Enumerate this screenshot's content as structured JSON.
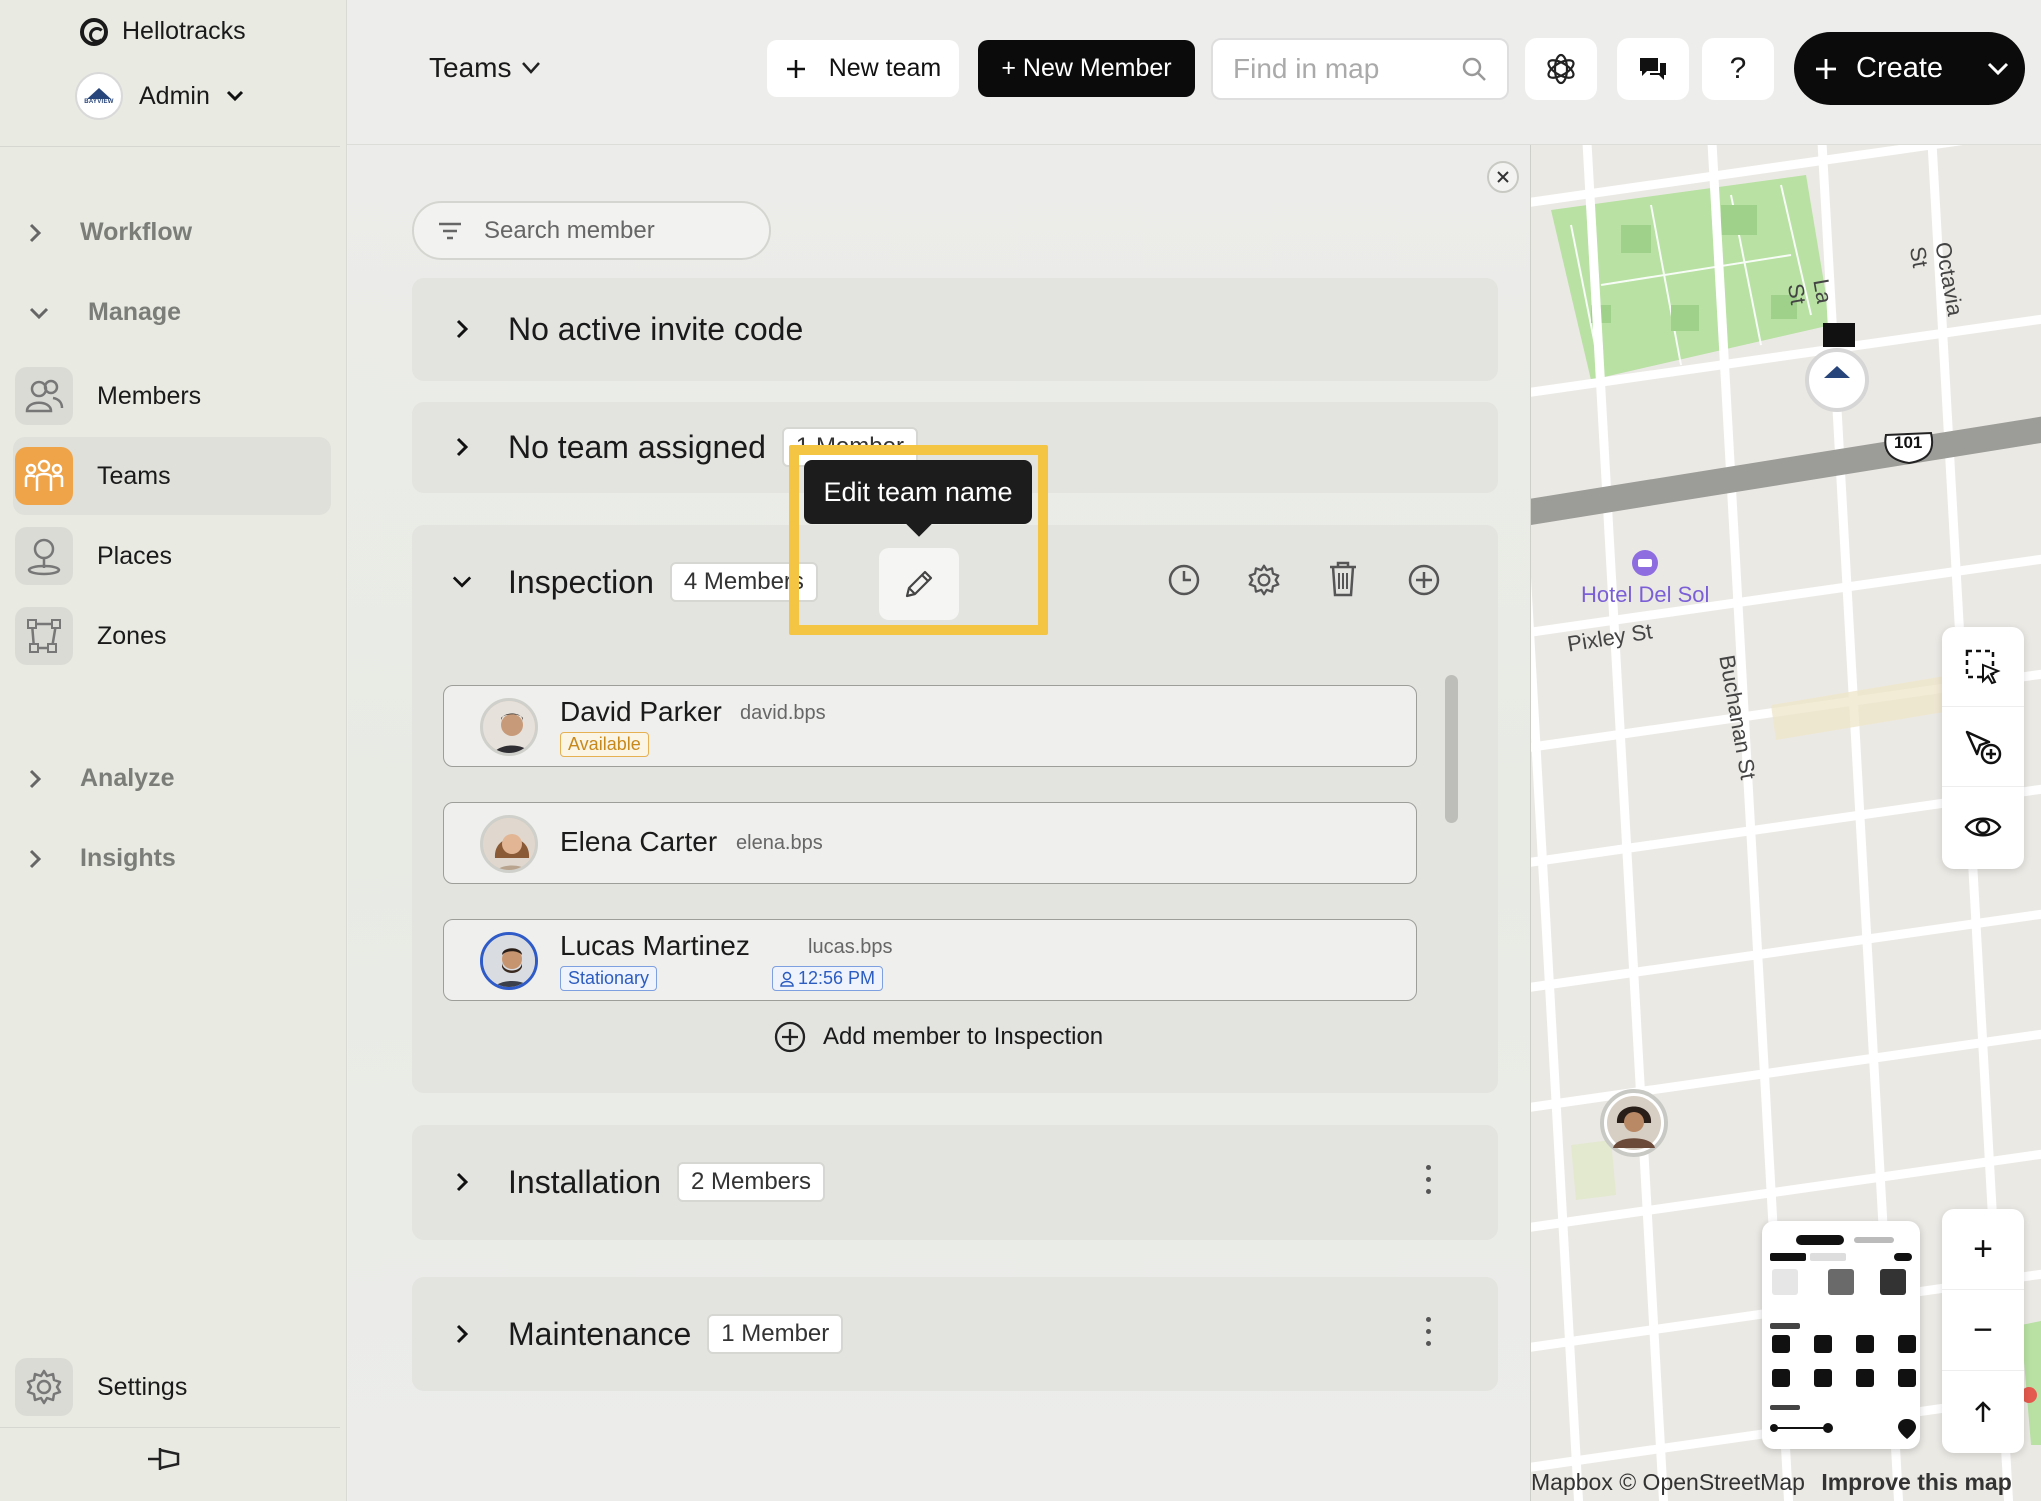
{
  "app": {
    "name": "Hellotracks",
    "account": "Admin",
    "account_logo_text": "BAYVIEW"
  },
  "sidebar": {
    "sections": [
      {
        "label": "Workflow"
      },
      {
        "label": "Manage"
      },
      {
        "label": "Analyze"
      },
      {
        "label": "Insights"
      }
    ],
    "items": [
      {
        "label": "Members"
      },
      {
        "label": "Teams"
      },
      {
        "label": "Places"
      },
      {
        "label": "Zones"
      }
    ],
    "settings": "Settings"
  },
  "topbar": {
    "view_selector": "Teams",
    "new_team": "New team",
    "new_member": "+ New Member",
    "find_placeholder": "Find in map",
    "help": "?",
    "create": "Create"
  },
  "panel": {
    "search_placeholder": "Search member",
    "groups": [
      {
        "name": "No active invite code"
      },
      {
        "name": "No team assigned",
        "count": "1 Member"
      },
      {
        "name": "Inspection",
        "count": "4 Members"
      },
      {
        "name": "Installation",
        "count": "2 Members"
      },
      {
        "name": "Maintenance",
        "count": "1 Member"
      }
    ],
    "members": [
      {
        "name": "David Parker",
        "username": "david.bps",
        "status": "Available"
      },
      {
        "name": "Elena Carter",
        "username": "elena.bps"
      },
      {
        "name": "Lucas Martinez",
        "username": "lucas.bps",
        "status": "Stationary",
        "time": "12:56 PM"
      }
    ],
    "add_member": "Add member to Inspection",
    "tooltip": "Edit team name"
  },
  "map": {
    "streets": [
      "Octavia St",
      "Laguna St",
      "Pixley St",
      "Buchanan St"
    ],
    "poi": "Hotel Del Sol",
    "highway": "101",
    "zoom_in": "+",
    "zoom_out": "−",
    "attribution": "Mapbox © OpenStreetMap",
    "improve": "Improve this map"
  },
  "colors": {
    "accent": "#f0a44a",
    "highlight": "#f4c542",
    "status_available": "#c8891c",
    "status_stationary": "#2d5cc0"
  }
}
